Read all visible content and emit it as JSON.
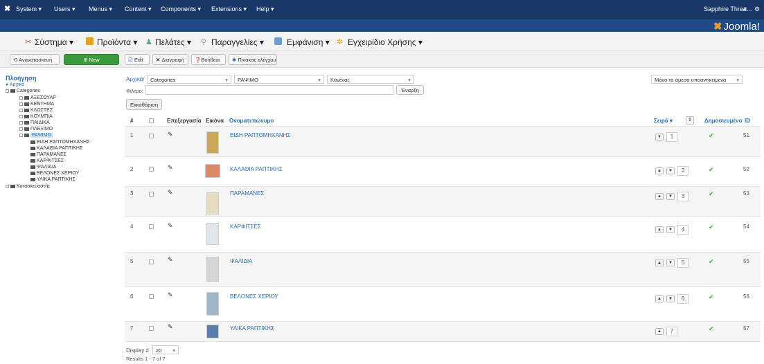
{
  "topbar": {
    "menus": [
      "System ▾",
      "Users ▾",
      "Menus ▾",
      "Content ▾",
      "Components ▾",
      "Extensions ▾",
      "Help ▾"
    ],
    "site_name": "Sapphire Threa...",
    "brand": "Joomla!"
  },
  "greek_menu": [
    "Σύστημα ▾",
    "Προϊόντα ▾",
    "Πελάτες ▾",
    "Παραγγελίες ▾",
    "Εμφάνιση ▾",
    "Εγχειρίδιο Χρήσης ▾"
  ],
  "toolbar": {
    "refresh": "Ανανατασκευή",
    "new": "New",
    "edit": "Edit",
    "delete": "Διαγραφή",
    "help": "Βοήθεια",
    "dashboard": "Πίνακας ελέγχου"
  },
  "sidebar": {
    "heading": "Πλοήγηση",
    "home": "Αρχικά",
    "root": "Categories",
    "items": [
      "ΑΞΕΣΟΥΑΡ",
      "ΚΕΝΤΗΜΑ",
      "ΚΛΩΣΤΕΣ",
      "ΚΟΥΜΠΙΑ",
      "ΠΑΙΔΙΚΑ",
      "ΠΛΕΞΙΜΟ",
      "ΡΑΨΙΜΟ"
    ],
    "children": [
      "ΕΙΔΗ ΡΑΠΤΟΜΗΧΑΝΗΣ",
      "ΚΑΛΑΘΙΑ ΡΑΠΤΙΚΗΣ",
      "ΠΑΡΑΜΑΝΕΣ",
      "ΚΑΡΦΙΤΣΕΣ",
      "ΨΑΛΙΔΙΑ",
      "ΒΕΛΟΝΕΣ ΧΕΡΙΟΥ",
      "ΥΛΙΚΑ ΡΑΠΤΙΚΗΣ"
    ],
    "manufacturer": "Κατασκευαστής"
  },
  "filters": {
    "breadcrumb": "Αρχικά/",
    "cat1": "Categories",
    "cat2": "ΡΑΨΙΜΟ",
    "cat3": "Κανένας",
    "filter_label": "Φίλτρο:",
    "filter_value": "",
    "go": "Έναρξη",
    "clear": "Εκκαθάριση",
    "scope": "Μόνο τα άμεσα υποαντικείμενα"
  },
  "table": {
    "headers": {
      "num": "#",
      "edit": "Επεξεργασία",
      "image": "Εικόνα",
      "name": "Ονοματεπώνυμο",
      "order": "Σειρά ▾",
      "published": "Δημοσιευμένο",
      "id": "ID"
    },
    "rows": [
      {
        "n": "1",
        "name": "ΕΙΔΗ ΡΑΠΤΟΜΗΧΑΝΗΣ",
        "order": "1",
        "id": "51"
      },
      {
        "n": "2",
        "name": "ΚΑΛΑΘΙΑ ΡΑΠΤΙΚΗΣ",
        "order": "2",
        "id": "52"
      },
      {
        "n": "3",
        "name": "ΠΑΡΑΜΑΝΕΣ",
        "order": "3",
        "id": "53"
      },
      {
        "n": "4",
        "name": "ΚΑΡΦΙΤΣΕΣ",
        "order": "4",
        "id": "54"
      },
      {
        "n": "5",
        "name": "ΨΑΛΙΔΙΑ",
        "order": "5",
        "id": "55"
      },
      {
        "n": "6",
        "name": "ΒΕΛΟΝΕΣ ΧΕΡΙΟΥ",
        "order": "6",
        "id": "56"
      },
      {
        "n": "7",
        "name": "ΥΛΙΚΑ ΡΑΠΤΙΚΗΣ",
        "order": "7",
        "id": "57"
      }
    ]
  },
  "footer": {
    "display_label": "Display #",
    "display_value": "20",
    "results": "Results 1 - 7 of 7"
  }
}
